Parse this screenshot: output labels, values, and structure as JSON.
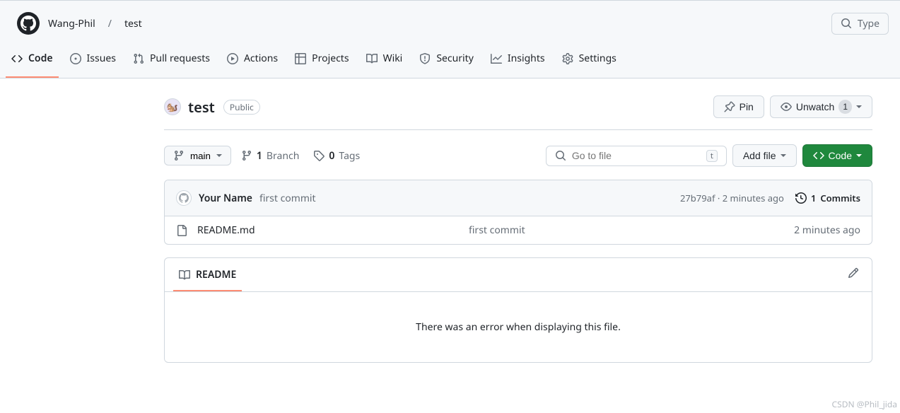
{
  "header": {
    "owner": "Wang-Phil",
    "separator": "/",
    "repo": "test",
    "search_placeholder": "Type"
  },
  "tabs": [
    {
      "label": "Code"
    },
    {
      "label": "Issues"
    },
    {
      "label": "Pull requests"
    },
    {
      "label": "Actions"
    },
    {
      "label": "Projects"
    },
    {
      "label": "Wiki"
    },
    {
      "label": "Security"
    },
    {
      "label": "Insights"
    },
    {
      "label": "Settings"
    }
  ],
  "repo": {
    "name": "test",
    "visibility": "Public",
    "pin_label": "Pin",
    "watch_label": "Unwatch",
    "watch_count": "1"
  },
  "toolbar": {
    "branch": "main",
    "branches_count": "1",
    "branches_label": "Branch",
    "tags_count": "0",
    "tags_label": "Tags",
    "file_search_placeholder": "Go to file",
    "file_search_kbd": "t",
    "add_file_label": "Add file",
    "code_label": "Code"
  },
  "commit": {
    "author": "Your Name",
    "message": "first commit",
    "sha": "27b79af",
    "time": "2 minutes ago",
    "commits_count": "1",
    "commits_label": "Commits"
  },
  "files": [
    {
      "name": "README.md",
      "message": "first commit",
      "date": "2 minutes ago"
    }
  ],
  "readme": {
    "tab_label": "README",
    "error_text": "There was an error when displaying this file."
  },
  "watermark": "CSDN @Phil_jida"
}
